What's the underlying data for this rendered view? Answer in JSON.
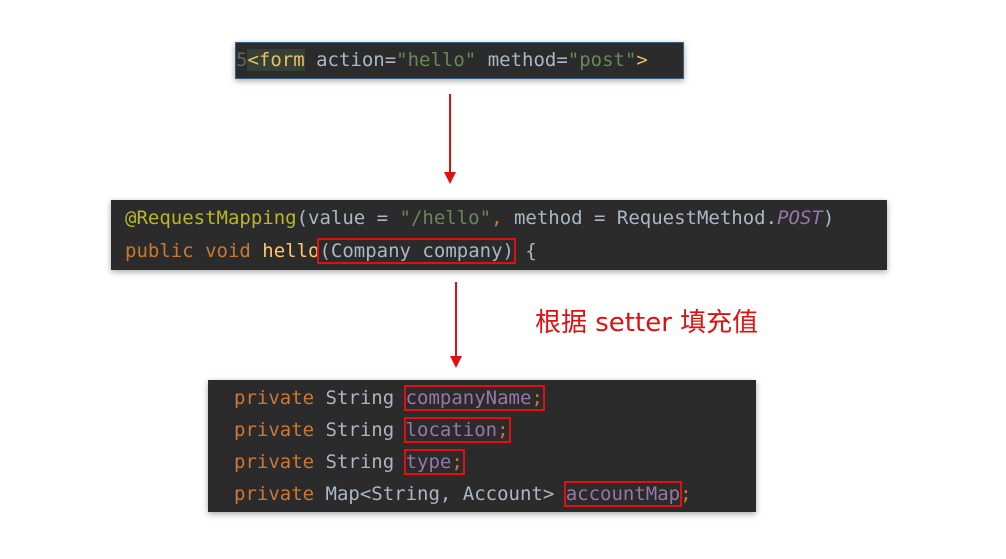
{
  "form_snippet": {
    "gutter": "5",
    "tag_open": "<form",
    "attr1_name": " action=",
    "attr1_value": "\"hello\"",
    "attr2_name": " method=",
    "attr2_value": "\"post\"",
    "tag_close": ">"
  },
  "controller_snippet": {
    "annotation": "@RequestMapping",
    "paren_open": "(value = ",
    "value_str": "\"/hello\"",
    "comma": ", ",
    "method_kw": "method = RequestMethod.",
    "method_const": "POST",
    "paren_close": ")",
    "public_kw": "public ",
    "void_kw": "void ",
    "fn_name": "hello",
    "param": "(Company company)",
    "brace": " {"
  },
  "annotation_text": "根据 setter 填充值",
  "fields_snippet": {
    "lines": [
      {
        "modifier": "private ",
        "type": "String ",
        "name": "companyName",
        "semi": ";"
      },
      {
        "modifier": "private ",
        "type": "String ",
        "name": "location",
        "semi": ";"
      },
      {
        "modifier": "private ",
        "type": "String ",
        "name": "type",
        "semi": ";"
      },
      {
        "modifier": "private ",
        "type": "Map<String, Account> ",
        "name": "accountMap",
        "semi": ";"
      }
    ]
  },
  "colors": {
    "background": "#2b2b2b",
    "highlight_box": "#e01010",
    "keyword": "#cc7832",
    "string": "#6a8759",
    "field": "#9876aa"
  }
}
